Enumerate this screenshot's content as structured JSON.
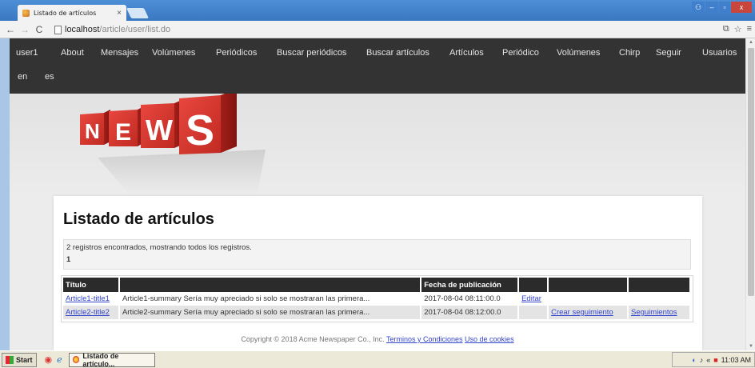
{
  "browser": {
    "tab_title": "Listado de artículos",
    "tab_close": "×",
    "url_host": "localhost",
    "url_path": "/article/user/list.do"
  },
  "nav": {
    "row1": [
      "user1",
      "About",
      "Mensajes",
      "Volúmenes",
      "Periódicos",
      "Buscar periódicos",
      "Buscar artículos",
      "Artículos",
      "Periódico",
      "Volúmenes",
      "Chirp",
      "Seguir",
      "Usuarios"
    ],
    "row2": [
      "en",
      "es"
    ]
  },
  "banner": {
    "letters": [
      "N",
      "E",
      "W",
      "S"
    ]
  },
  "page": {
    "title": "Listado de artículos",
    "records_info": "2 registros encontrados, mostrando todos los registros.",
    "page_number": "1"
  },
  "table": {
    "headers": [
      "Título",
      "",
      "Fecha de publicación",
      "",
      "",
      ""
    ],
    "rows": [
      {
        "title": "Article1-title1",
        "summary": "Article1-summary Sería muy apreciado si solo se mostraran las primera...",
        "date": "2017-08-04 08:11:00.0",
        "edit": "Editar",
        "follow": "",
        "followers": ""
      },
      {
        "title": "Article2-title2",
        "summary": "Article2-summary Sería muy apreciado si solo se mostraran las primera...",
        "date": "2017-08-04 08:12:00.0",
        "edit": "",
        "follow": "Crear seguimiento",
        "followers": "Seguimientos"
      }
    ]
  },
  "footer": {
    "copyright": "Copyright © 2018 Acme Newspaper Co., Inc.",
    "terms": "Terminos y Condiciones",
    "cookies": "Uso de cookies"
  },
  "taskbar": {
    "start": "Start",
    "task": "Listado de artículo...",
    "clock": "11:03 AM"
  },
  "colors": {
    "navbar": "#333333",
    "link": "#3344cc",
    "banner_red": "#d9342b"
  }
}
